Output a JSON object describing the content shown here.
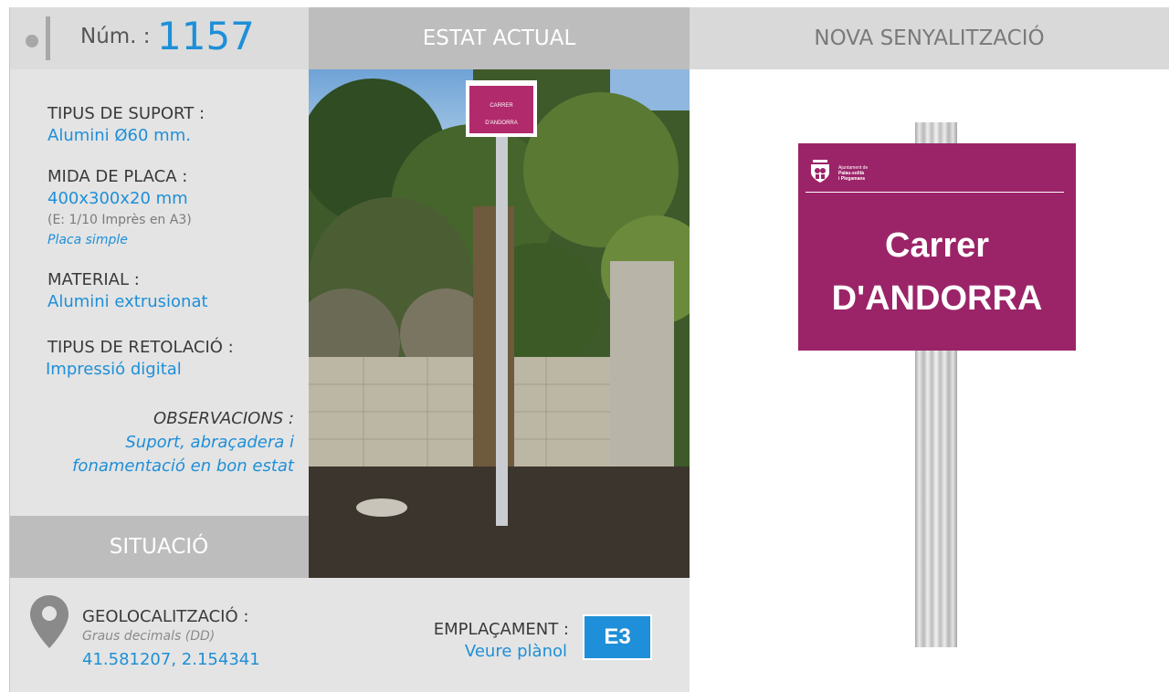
{
  "header": {
    "num_label": "Núm. :",
    "num_value": "1157",
    "estat_actual": "ESTAT ACTUAL",
    "nova_senyalitzacio": "NOVA SENYALITZACIÓ"
  },
  "info": {
    "suport_label": "TIPUS DE SUPORT :",
    "suport_value": "Alumini Ø60 mm.",
    "mida_label": "MIDA DE PLACA :",
    "mida_value": "400x300x20 mm",
    "mida_note": "(E: 1/10 Imprès en A3)",
    "mida_type": "Placa simple",
    "material_label": "MATERIAL :",
    "material_value": "Alumini extrusionat",
    "retolacio_label": "TIPUS DE RETOLACIÓ :",
    "retolacio_value": "Impressió digital",
    "observacions_label": "OBSERVACIONS :",
    "observacions_line1": "Suport, abraçadera i",
    "observacions_line2": "fonamentació en bon estat"
  },
  "situacio": {
    "title": "SITUACIÓ",
    "geo_label": "GEOLOCALITZACIÓ :",
    "geo_note": "Graus decimals (DD)",
    "geo_value": "41.581207, 2.154341",
    "emplacament_label": "EMPLAÇAMENT :",
    "emplacament_value": "Veure plànol",
    "emplacament_code": "E3"
  },
  "photo": {
    "sign_line1": "CARRER",
    "sign_line2": "D'ANDORRA"
  },
  "new_sign": {
    "logo_line1": "Ajuntament de",
    "logo_line2": "Palau-solità",
    "logo_line3": "i Plegamans",
    "street": "Carrer",
    "name": "D'ANDORRA"
  },
  "colors": {
    "accent_blue": "#1e8fd8",
    "sign_magenta": "#9b2468",
    "header_grey": "#bdbdbd"
  }
}
